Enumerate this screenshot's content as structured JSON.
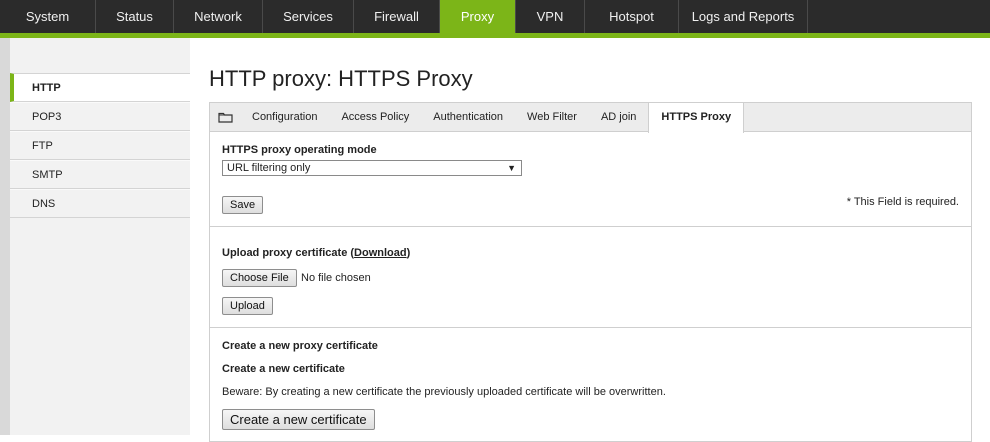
{
  "topnav": {
    "items": [
      "System",
      "Status",
      "Network",
      "Services",
      "Firewall",
      "Proxy",
      "VPN",
      "Hotspot",
      "Logs and Reports"
    ],
    "active": "Proxy",
    "accent": "#7cb518"
  },
  "sidebar": {
    "items": [
      "HTTP",
      "POP3",
      "FTP",
      "SMTP",
      "DNS"
    ],
    "active": "HTTP"
  },
  "page": {
    "title": "HTTP proxy: HTTPS Proxy"
  },
  "tabs": {
    "icon": "folder-icon",
    "items": [
      "Configuration",
      "Access Policy",
      "Authentication",
      "Web Filter",
      "AD join",
      "HTTPS Proxy"
    ],
    "active": "HTTPS Proxy"
  },
  "mode_section": {
    "label": "HTTPS proxy operating mode",
    "selected": "URL filtering only",
    "save_label": "Save",
    "required_note": "* This Field is required."
  },
  "upload_section": {
    "label_prefix": "Upload proxy certificate (",
    "download_link": "Download",
    "label_suffix": ")",
    "choose_file_label": "Choose File",
    "no_file_text": "No file chosen",
    "upload_label": "Upload"
  },
  "create_section": {
    "heading": "Create a new proxy certificate",
    "subheading": "Create a new certificate",
    "warning": "Beware: By creating a new certificate the previously uploaded certificate will be overwritten.",
    "create_button_label": "Create a new certificate"
  }
}
